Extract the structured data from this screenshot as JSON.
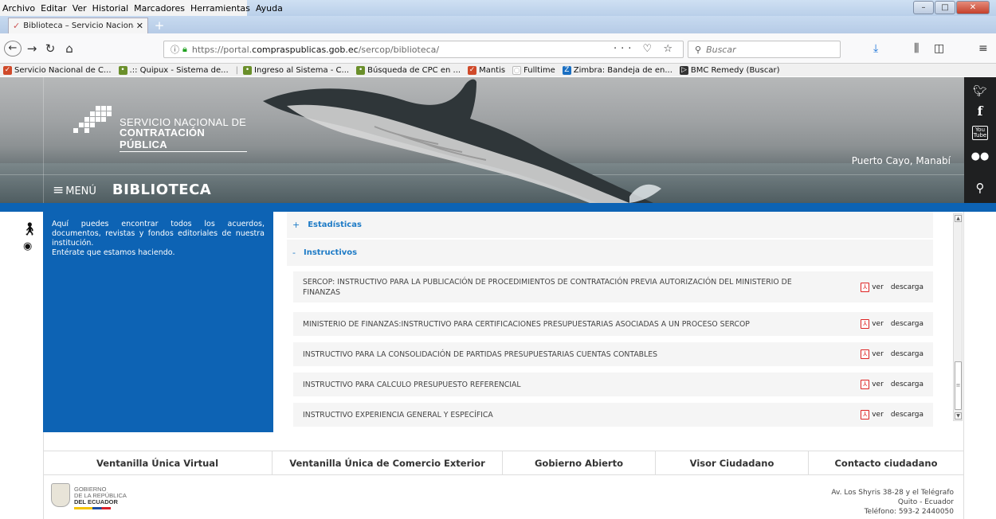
{
  "menubar": {
    "items": [
      "Archivo",
      "Editar",
      "Ver",
      "Historial",
      "Marcadores",
      "Herramientas",
      "Ayuda"
    ]
  },
  "tab": {
    "title": "Biblioteca – Servicio Nacional d"
  },
  "urlbar": {
    "url_pre": "https://portal.",
    "url_host": "compraspublicas.gob.ec",
    "url_post": "/sercop/biblioteca/",
    "actions": "··· ♡ ☆"
  },
  "searchbar": {
    "placeholder": "Buscar"
  },
  "bookmarks": [
    {
      "label": "Servicio Nacional de C...",
      "color": "#d04a2a"
    },
    {
      "label": ".:: Quipux - Sistema de...",
      "color": "#6a8f2a"
    },
    {
      "label": "Ingreso al Sistema - C...",
      "color": "#6a8f2a"
    },
    {
      "label": "Búsqueda de CPC en ...",
      "color": "#6a8f2a"
    },
    {
      "label": "Mantis",
      "color": "#d04a2a"
    },
    {
      "label": "Fulltime",
      "color": "#bbbbbb"
    },
    {
      "label": "Zimbra: Bandeja de en...",
      "color": "#1a6fc2"
    },
    {
      "label": "BMC Remedy (Buscar)",
      "color": "#333333"
    }
  ],
  "hero": {
    "org_line1": "SERVICIO NACIONAL DE",
    "org_line2": "CONTRATACIÓN PÚBLICA",
    "place": "Puerto Cayo, Manabí",
    "menu_label": "MENÚ",
    "section_title": "BIBLIOTECA"
  },
  "intro": {
    "text": "Aquí puedes encontrar todos los acuerdos, documentos, revistas y fondos editoriales de nuestra institución.",
    "text2": "Entérate que estamos haciendo."
  },
  "sections": {
    "estadisticas": {
      "sign": "+",
      "label": "Estadísticas"
    },
    "instructivos": {
      "sign": "-",
      "label": "Instructivos"
    }
  },
  "documents": [
    {
      "title": "SERCOP: INSTRUCTIVO PARA LA PUBLICACIÓN DE PROCEDIMIENTOS DE CONTRATACIÓN PREVIA AUTORIZACIÓN DEL MINISTERIO DE FINANZAS"
    },
    {
      "title": "MINISTERIO DE FINANZAS:INSTRUCTIVO PARA CERTIFICACIONES PRESUPUESTARIAS ASOCIADAS A UN PROCESO SERCOP"
    },
    {
      "title": "INSTRUCTIVO PARA LA CONSOLIDACIÓN DE PARTIDAS PRESUPUESTARIAS CUENTAS CONTABLES"
    },
    {
      "title": "INSTRUCTIVO PARA CALCULO PRESUPUESTO REFERENCIAL"
    },
    {
      "title": "INSTRUCTIVO EXPERIENCIA GENERAL Y ESPECÍFICA"
    }
  ],
  "doc_actions": {
    "view": "ver",
    "download": "descarga"
  },
  "footer_nav": [
    "Ventanilla Única Virtual",
    "Ventanilla Única de Comercio Exterior",
    "Gobierno Abierto",
    "Visor Ciudadano",
    "Contacto ciudadano"
  ],
  "footer": {
    "gov_line1": "GOBIERNO",
    "gov_line2": "DE LA REPÚBLICA",
    "gov_line3": "DEL ECUADOR",
    "address1": "Av. Los Shyris 38-28 y el Telégrafo",
    "address2": "Quito - Ecuador",
    "address3": "Teléfono: 593-2 2440050"
  },
  "colors": {
    "brand_blue": "#0d63b4",
    "link_blue": "#1e7bc6",
    "pdf_red": "#d22222"
  }
}
